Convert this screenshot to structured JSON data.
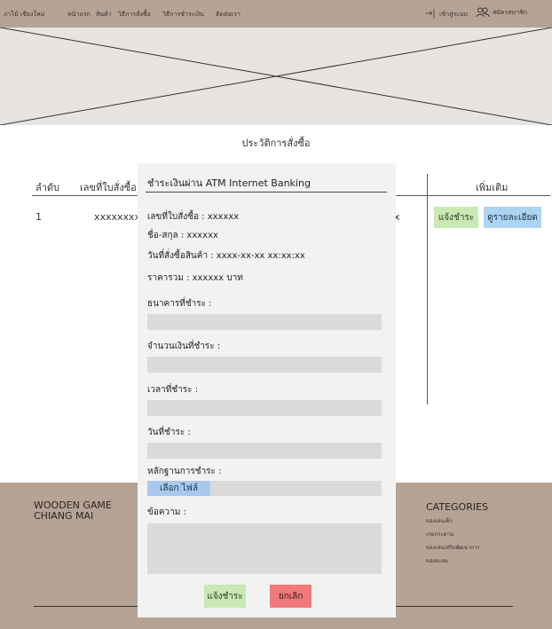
{
  "nav": {
    "items": [
      "ภาไม้ เชียงใหม่",
      "หน้าแรก",
      "สินค้า",
      "วิธีการสั่งซื้อ",
      "วิธีการชำระเงิน",
      "ติดต่อเรา"
    ],
    "login": "เข้าสู่ระบบ",
    "register": "สมัครสมาชิก"
  },
  "page_title": "ประวัติการสั่งซื้อ",
  "table": {
    "headers": [
      "ลำดับ",
      "เลขที่ใบสั่งซื้อ",
      "เพิ่มเติม"
    ],
    "row": {
      "index": "1",
      "order_no": "xxxxxxxxx",
      "trail": "x",
      "notify_label": "แจ้งชำระ",
      "detail_label": "ดูรายละเอียด"
    }
  },
  "modal": {
    "title": "ชำระเงินผ่าน ATM Internet Banking",
    "order_no": "เลขที่ใบสั่งซื้อ : xxxxxx",
    "name": "ชื่อ-สกุล : xxxxxx",
    "order_date": "วันที่สั่งซื้อสินค้า : xxxx-xx-xx xx:xx:xx",
    "total": "ราคารวม : xxxxxx บาท",
    "bank_label": "ธนาคารที่ชำระ :",
    "amount_label": "จำนวนเงินที่ชำระ :",
    "time_label": "เวลาที่ชำระ :",
    "date_label": "วันที่ชำระ :",
    "evidence_label": "หลักฐานการชำระ :",
    "file_button": "เลือก ไฟล์",
    "message_label": "ข้อความ :",
    "confirm_label": "แจ้งชำระ",
    "cancel_label": "ยกเลิก"
  },
  "footer": {
    "brand_line1": "WOODEN GAME",
    "brand_line2": "CHIANG MAI",
    "categories_title": "CATEGORIES",
    "categories": [
      "ของเล่นเด็ก",
      "เกมกระดาน",
      "ของเล่นเสริมพัฒนาการ",
      "ของสะสม"
    ]
  },
  "colors": {
    "nav_bg": "#b5a395",
    "banner_bg": "#e6e3e1",
    "notify_btn": "#c9e8b4",
    "detail_btn": "#acd5f3",
    "cancel_btn": "#f07a7a",
    "file_btn": "#a8c9ed",
    "input_bg": "#dadada",
    "modal_bg": "#f2f2f2"
  }
}
